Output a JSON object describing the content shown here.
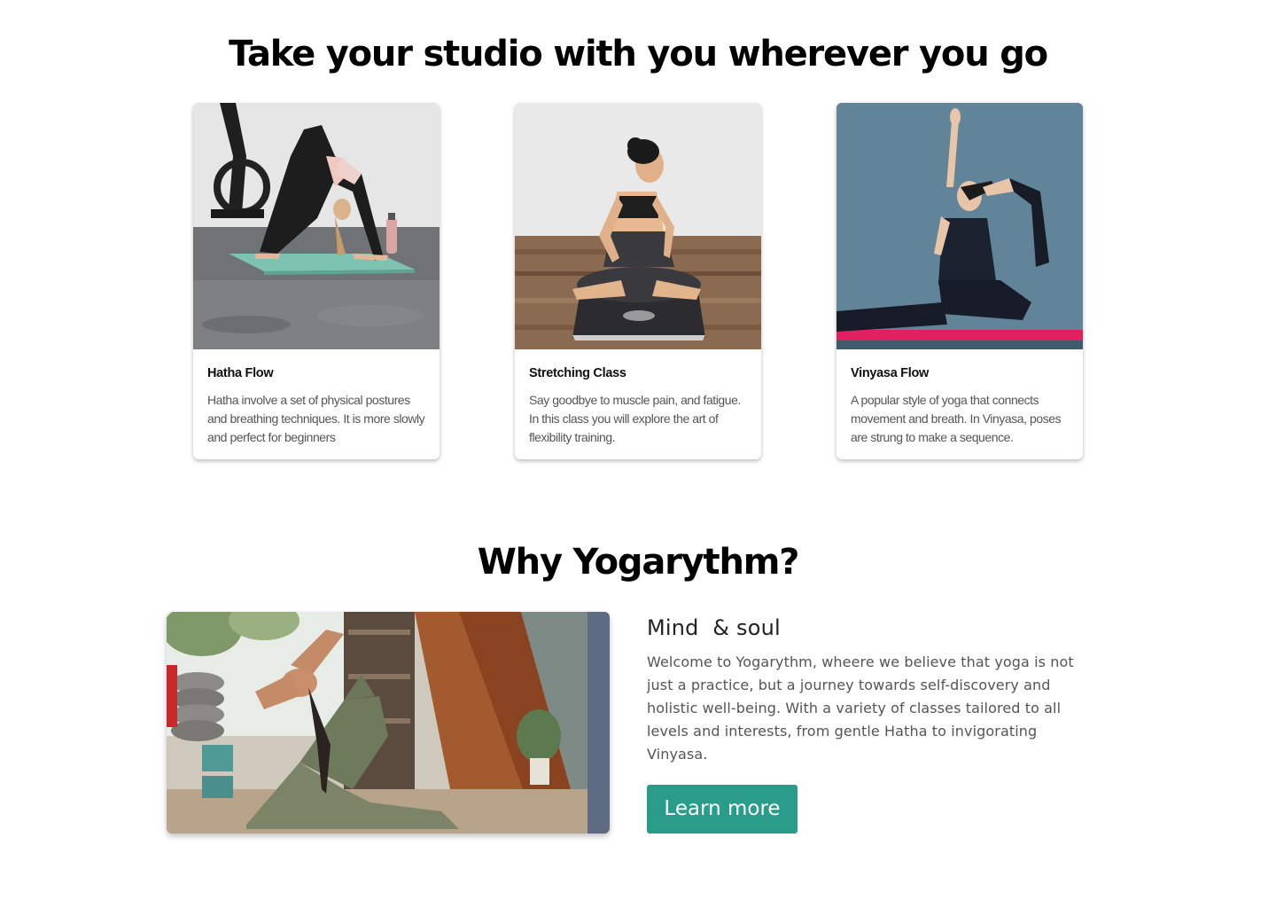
{
  "studio_section": {
    "title": "Take your studio with you wherever you go",
    "cards": [
      {
        "image": "woman-downward-dog-on-mint-mat-photo",
        "title": "Hatha Flow",
        "description": "Hatha involve a set of physical postures and breathing techniques. It is more slowly and perfect for beginners"
      },
      {
        "image": "woman-seated-twist-on-dark-mat-photo",
        "title": "Stretching Class",
        "description": "Say goodbye to muscle pain, and fatigue. In this class you will explore the art of flexibility training."
      },
      {
        "image": "woman-king-pigeon-pose-on-pink-mat-photo",
        "title": "Vinyasa Flow",
        "description": "A popular style of yoga that connects movement and breath. In Vinyasa, poses are strung to make a sequence."
      }
    ]
  },
  "why_section": {
    "title": "Why Yogarythm?",
    "image": "woman-backbend-pose-indoors-photo",
    "heading": "Mind  & soul",
    "body": "Welcome to Yogarythm, wheere we believe that yoga is not just a practice, but a journey towards self-discovery and holistic well-being. With a variety of classes tailored to all levels and interests, from gentle Hatha to invigorating Vinyasa.",
    "button_label": "Learn more"
  },
  "colors": {
    "accent": "#2a9d8a",
    "heading": "#000000",
    "body_text": "#555555"
  }
}
